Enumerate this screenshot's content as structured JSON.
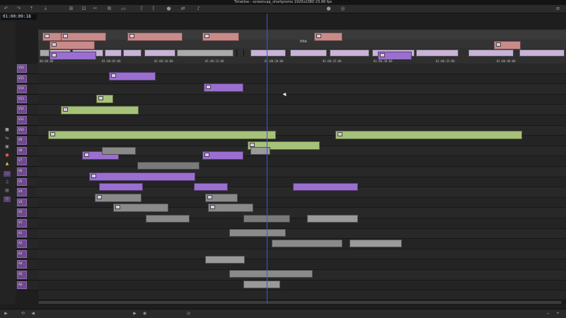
{
  "window": {
    "title": "Timeline - screencap_shortpromo 1920x1080 23.98 fps"
  },
  "toolbar": {
    "icons": [
      "undo-icon",
      "redo-icon",
      "lift-icon",
      "extract-icon",
      "splice-icon",
      "overwrite-icon",
      "add-edit-icon",
      "trim-icon",
      "segment-icon",
      "mark-in-icon",
      "mark-out-icon",
      "clear-marks-icon",
      "match-frame-icon",
      "audio-icon",
      "record-icon",
      "zoom-icon",
      "settings-icon"
    ]
  },
  "timecode": {
    "value": "01:00:09:18"
  },
  "overview": {
    "filler_label": "filler",
    "title_label": "title",
    "ruler_labels": [
      "00:00:00",
      "01:00:05:00",
      "01:00:10:00",
      "01:00:15:00",
      "01:00:20:00",
      "01:00:25:00",
      "01:00:30:00",
      "01:00:35:00",
      "01:00:40:00"
    ]
  },
  "tracks": [
    {
      "name": "V16"
    },
    {
      "name": "V15"
    },
    {
      "name": "V14"
    },
    {
      "name": "V13"
    },
    {
      "name": "V12"
    },
    {
      "name": "V11"
    },
    {
      "name": "V10"
    },
    {
      "name": "V9"
    },
    {
      "name": "V8"
    },
    {
      "name": "V7"
    },
    {
      "name": "V6"
    },
    {
      "name": "V5"
    },
    {
      "name": "V4"
    },
    {
      "name": "V3"
    },
    {
      "name": "V2"
    },
    {
      "name": "V1"
    },
    {
      "name": "A1"
    },
    {
      "name": "A2"
    },
    {
      "name": "A3"
    },
    {
      "name": "A4"
    },
    {
      "name": "A5"
    },
    {
      "name": "A6"
    }
  ],
  "clips": [
    {
      "lane": 0,
      "color": "#c98a8a",
      "label": "",
      "t": "title"
    },
    {
      "lane": 0,
      "color": "#c98a8a",
      "label": "",
      "t": "title"
    },
    {
      "lane": 0,
      "color": "#c98a8a",
      "label": "",
      "t": "title"
    },
    {
      "lane": 0,
      "color": "#c98a8a",
      "label": "",
      "t": "title"
    },
    {
      "lane": 0,
      "color": "#c98a8a",
      "label": "",
      "t": "title"
    },
    {
      "lane": 1,
      "color": "#c98a8a",
      "label": "",
      "t": "title"
    },
    {
      "lane": 1,
      "color": "#c98a8a",
      "label": "",
      "t": "title"
    },
    {
      "lane": 2,
      "color": "#9a6fd0",
      "label": "",
      "t": "video"
    },
    {
      "lane": 2,
      "color": "#9a6fd0",
      "label": "",
      "t": "video"
    },
    {
      "lane": 4,
      "color": "#9a6fd0",
      "label": "",
      "t": "video"
    },
    {
      "lane": 5,
      "color": "#9a6fd0",
      "label": "",
      "t": "video"
    },
    {
      "lane": 6,
      "color": "#a6c27a",
      "label": "",
      "t": "green"
    },
    {
      "lane": 7,
      "color": "#a6c27a",
      "label": "",
      "t": "green"
    },
    {
      "lane": 8,
      "color": "#a6c27a",
      "label": "",
      "t": "green"
    },
    {
      "lane": 9,
      "color": "#a6c27a",
      "label": "",
      "t": "green"
    },
    {
      "lane": 10,
      "color": "#a6c27a",
      "label": "",
      "t": "green"
    },
    {
      "lane": 11,
      "color": "#9a6fd0",
      "label": "",
      "t": "video"
    },
    {
      "lane": 12,
      "color": "#9a6fd0",
      "label": "",
      "t": "video"
    },
    {
      "lane": 13,
      "color": "#9a6fd0",
      "label": "",
      "t": "video"
    },
    {
      "lane": 14,
      "color": "#8a8a8a",
      "label": "",
      "t": "grey"
    },
    {
      "lane": 15,
      "color": "#8a8a8a",
      "label": "",
      "t": "grey"
    },
    {
      "lane": 16,
      "color": "#8a8a8a",
      "label": "",
      "t": "grey"
    },
    {
      "lane": 17,
      "color": "#8a8a8a",
      "label": "",
      "t": "grey"
    }
  ],
  "bottom": {
    "icons": [
      "play-icon",
      "loop-icon",
      "rewind-icon",
      "forward-icon",
      "mute-icon",
      "solo-icon",
      "zoom-out-icon",
      "zoom-in-icon"
    ]
  },
  "colors": {
    "accent": "#8e68ae",
    "playhead": "#3a55e0",
    "title_clip": "#c98a8a",
    "video_clip": "#9a6fd0",
    "green_clip": "#a6c27a",
    "grey_clip": "#8a8a8a"
  }
}
